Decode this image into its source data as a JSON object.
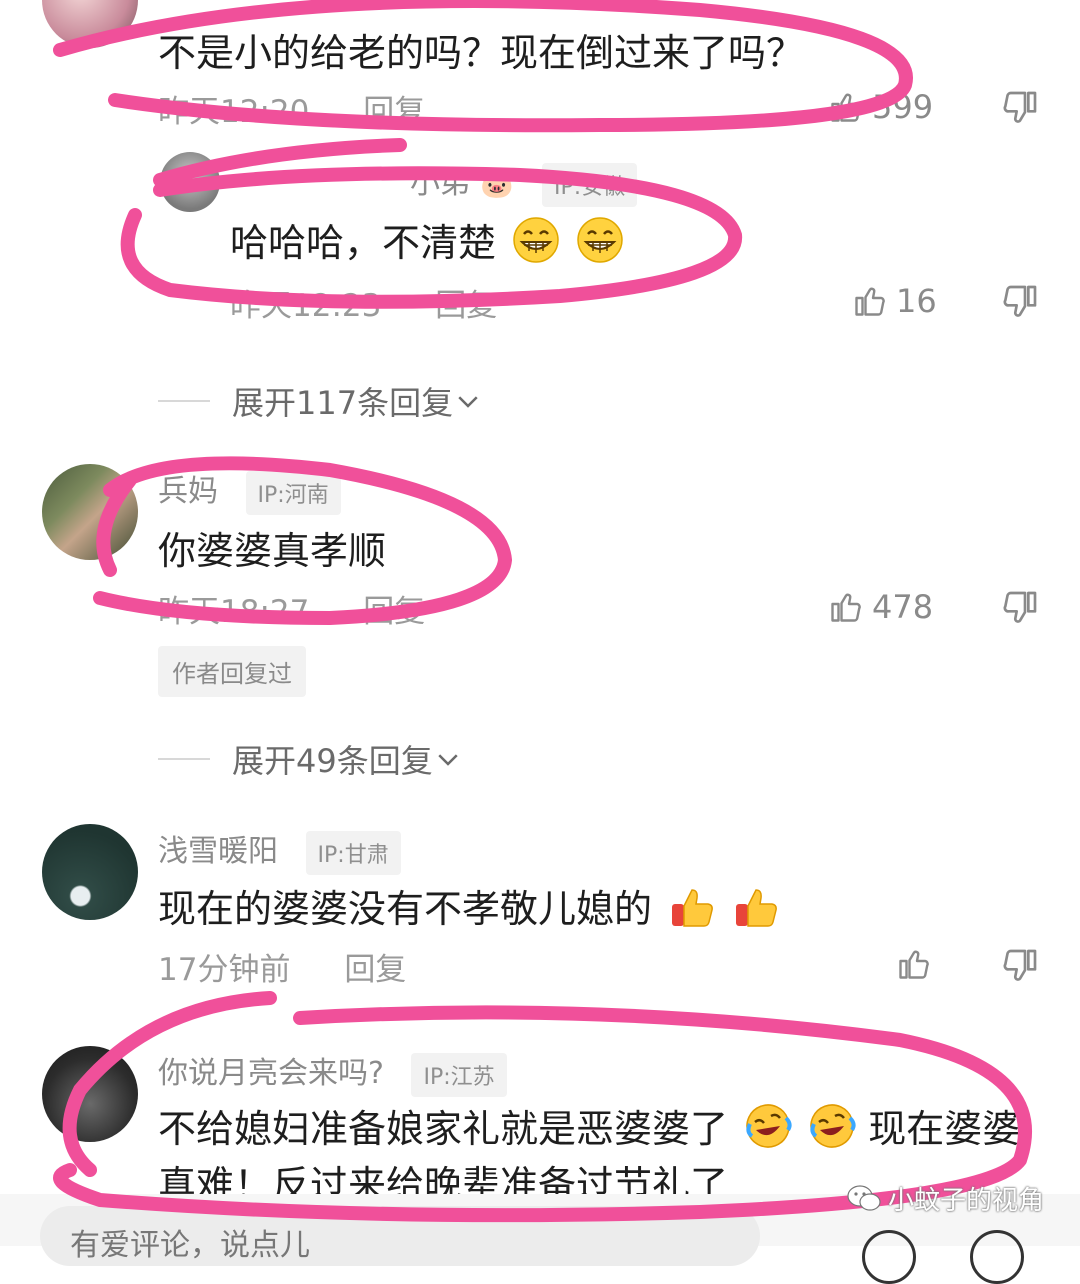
{
  "comments": [
    {
      "text": "不是小的给老的吗？现在倒过来了吗？",
      "time": "昨天12:20",
      "reply_label": "回复",
      "likes": "599"
    },
    {
      "name": "小弟",
      "ip": "IP:安徽",
      "text": "哈哈哈，不清楚",
      "time": "昨天12:23",
      "reply_label": "回复",
      "likes": "16"
    },
    {
      "name": "兵妈",
      "ip": "IP:河南",
      "text": "你婆婆真孝顺",
      "time": "昨天18:27",
      "reply_label": "回复",
      "likes": "478",
      "author_badge": "作者回复过"
    },
    {
      "name": "浅雪暖阳",
      "ip": "IP:甘肃",
      "text": "现在的婆婆没有不孝敬儿媳的",
      "time": "17分钟前",
      "reply_label": "回复"
    },
    {
      "name": "你说月亮会来吗?",
      "ip": "IP:江苏",
      "text_line1": "不给媳妇准备娘家礼就是恶婆婆了",
      "text_line1_tail": "现在婆婆",
      "text_line2": "真难！反过来给晚辈准备过节礼了"
    }
  ],
  "expand_1": "展开117条回复",
  "expand_2": "展开49条回复",
  "watermark": "小蚊子的视角",
  "bottom_input_placeholder": "有爱评论，说点儿",
  "colors": {
    "highlight": "#f0509a",
    "text": "#1e1e1e",
    "meta": "#9a9a9a"
  },
  "icons": [
    "thumb-up-icon",
    "thumb-down-icon",
    "chevron-down-icon",
    "grin-emoji",
    "thumbs-up-emoji",
    "laugh-cry-emoji",
    "wechat-icon"
  ]
}
